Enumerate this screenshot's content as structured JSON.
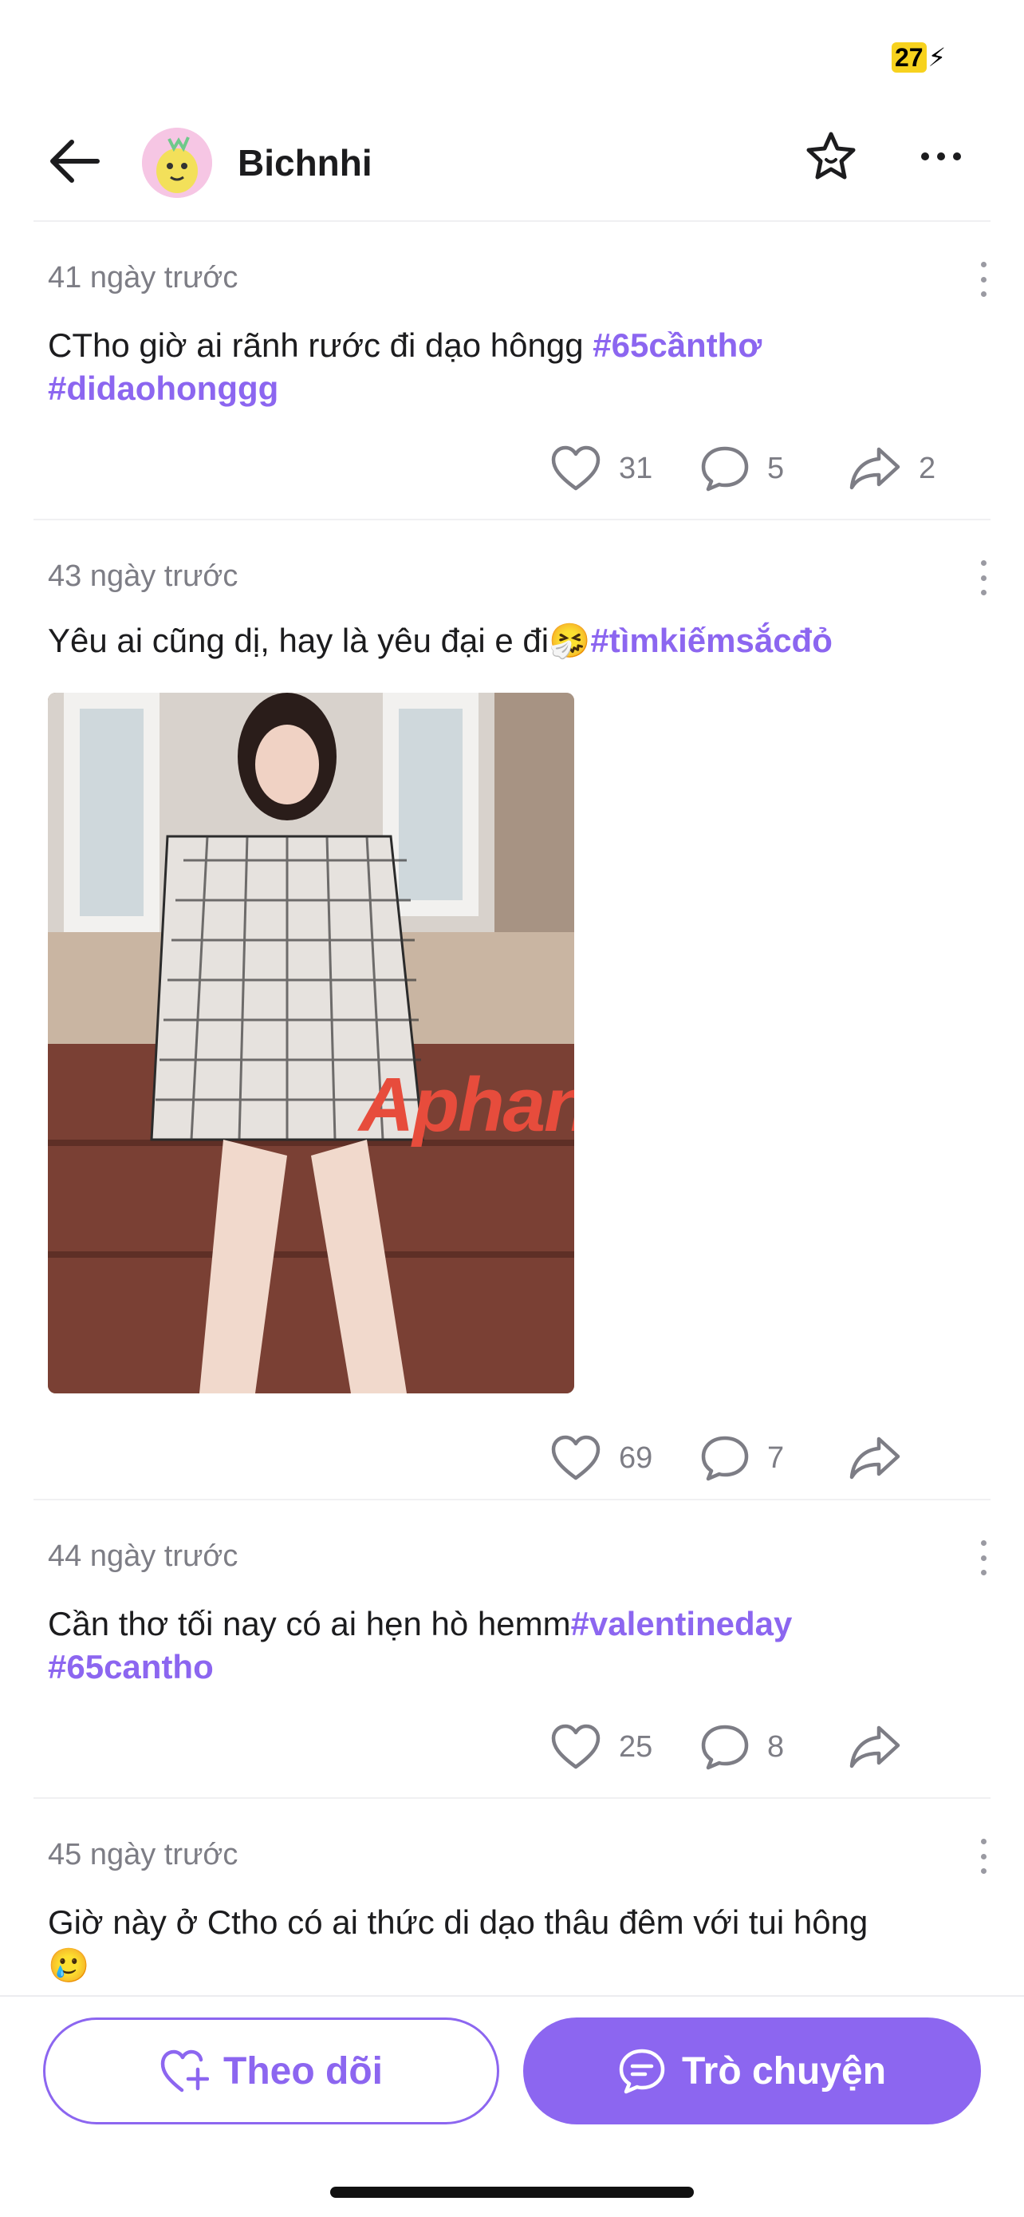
{
  "status_bar": {
    "battery": "27"
  },
  "header": {
    "profile_name": "Bichnhi"
  },
  "posts": [
    {
      "time": "41 ngày trước",
      "text": "CTho giờ ai rãnh rước đi dạo hôngg ",
      "hashtags": [
        "#65cầnthơ",
        "#didaohonggg"
      ],
      "likes": "31",
      "comments": "5",
      "shares": "2"
    },
    {
      "time": "43 ngày trước",
      "text": "Yêu ai cũng dị, hay là yêu đại e đi",
      "emoji": "🤧",
      "hashtags": [
        "#tìmkiếmsắcđỏ"
      ],
      "watermark": "Aphang",
      "likes": "69",
      "comments": "7"
    },
    {
      "time": "44 ngày trước",
      "text": "Cần thơ tối nay có ai hẹn hò hemm",
      "hashtags": [
        "#valentineday",
        "#65cantho"
      ],
      "likes": "25",
      "comments": "8"
    },
    {
      "time": "45 ngày trước",
      "text": "Giờ này ở Ctho có ai thức di dạo thâu đêm với tui hông",
      "emoji": "🥲"
    }
  ],
  "bottom_bar": {
    "follow_label": "Theo dõi",
    "chat_label": "Trò chuyện"
  },
  "colors": {
    "accent": "#8c66f0",
    "battery": "#f7d21e"
  },
  "icons": [
    "back-arrow-icon",
    "star-icon",
    "more-icon",
    "heart-icon",
    "comment-icon",
    "share-icon",
    "heart-plus-icon",
    "chat-bubble-icon"
  ]
}
